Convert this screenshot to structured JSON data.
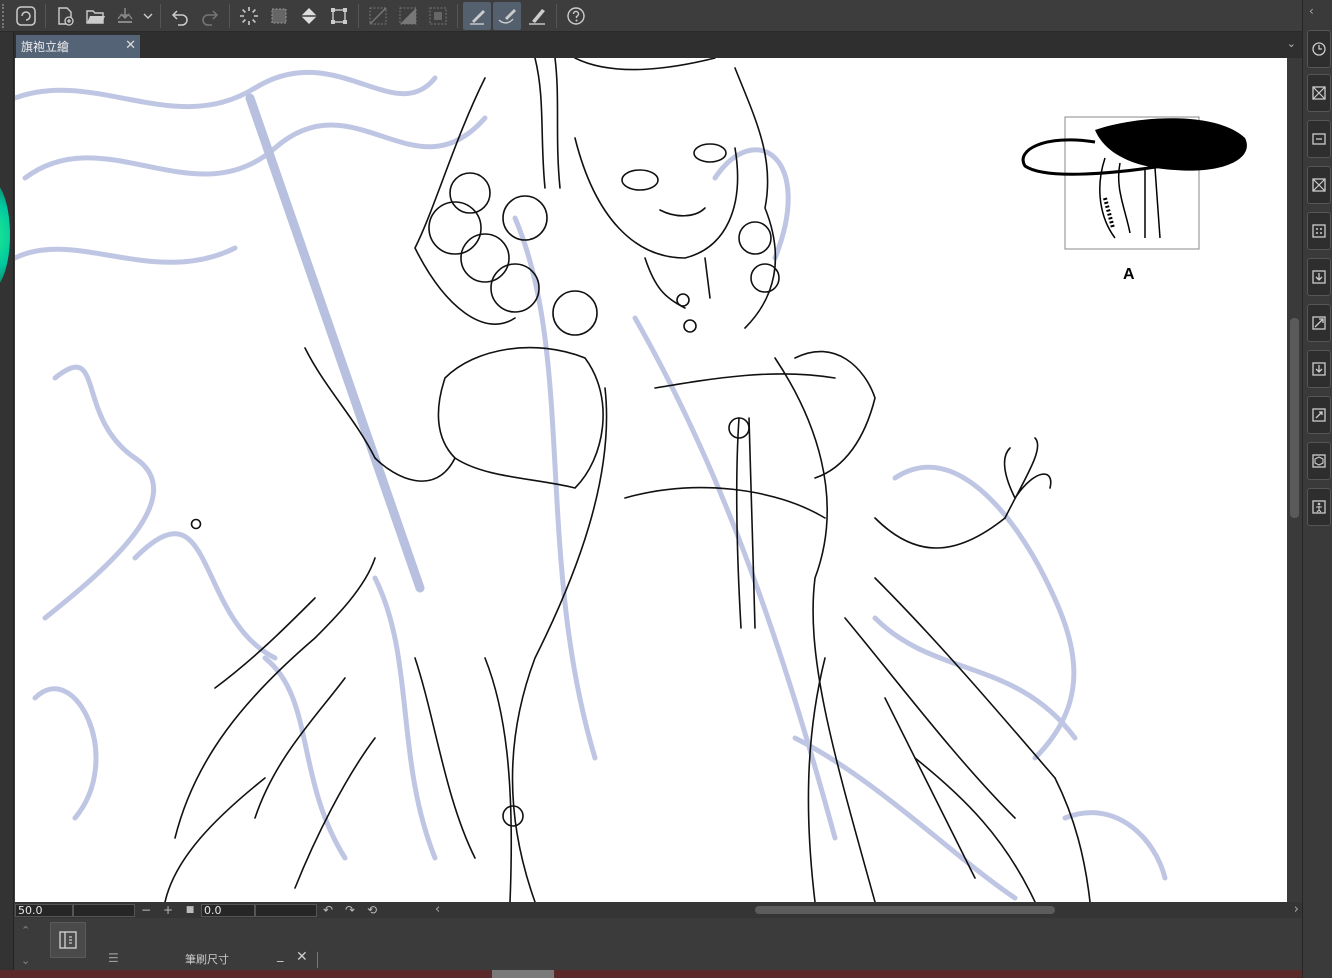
{
  "document": {
    "tab_label": "旗袍立繪",
    "close_glyph": "✕"
  },
  "toolbar": {
    "icons": [
      "app-logo-icon",
      "new-file-icon",
      "open-folder-icon",
      "save-icon",
      "dropdown-arrow-icon",
      "undo-icon",
      "redo-icon",
      "loading-spinner-icon",
      "selection-icon",
      "fill-icon",
      "transform-icon",
      "clear-outside-icon",
      "fill-selection-icon",
      "deselect-icon",
      "pen-tool-icon",
      "brush-tool-icon",
      "eraser-tool-icon",
      "help-icon"
    ]
  },
  "status": {
    "zoom_value": "50.0",
    "minus_glyph": "−",
    "plus_glyph": "+",
    "stop_glyph": "■",
    "angle_value": "0.0",
    "rotate_left_glyph": "↶",
    "rotate_right_glyph": "↷",
    "reset_glyph": "⟲",
    "scroll_left_glyph": "‹",
    "scroll_right_glyph": "›"
  },
  "bottom_panel": {
    "label": "筆刷尺寸",
    "menu_glyph": "☰",
    "minimize_glyph": "_",
    "close_glyph": "✕"
  },
  "thumbnail_badge": "A",
  "colors": {
    "toolbar_bg": "#3d3d3d",
    "tab_active": "#546476",
    "sketch_blue": "#b8c0e0",
    "lineart": "#111111",
    "canvas": "#ffffff",
    "active_tool": "#54606e"
  }
}
